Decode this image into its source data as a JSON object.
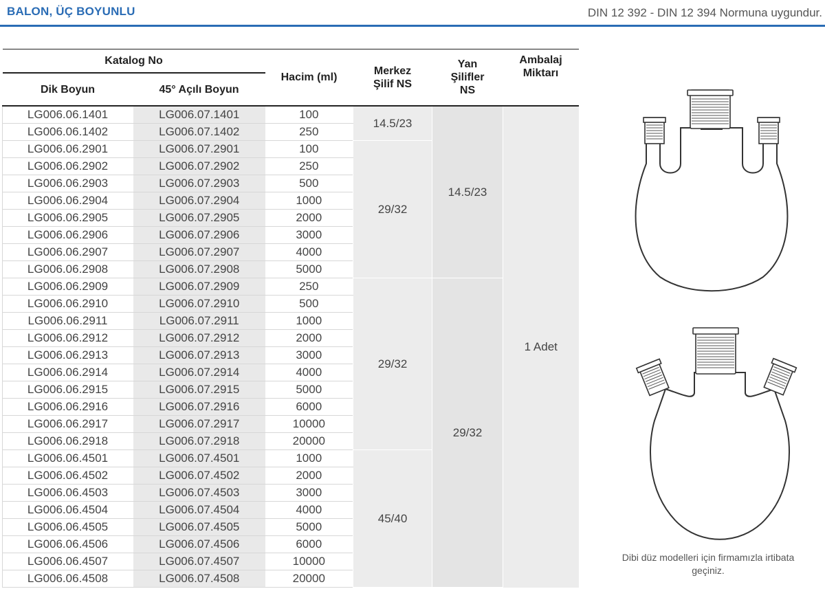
{
  "header": {
    "title": "BALON, ÜÇ BOYUNLU",
    "standard": "DIN 12 392 - DIN 12 394 Normuna uygundur."
  },
  "table": {
    "headers": {
      "katalog": "Katalog No",
      "dik": "Dik Boyun",
      "acili": "45° Açılı Boyun",
      "hacim": "Hacim (ml)",
      "merkez": "Merkez Şilif NS",
      "yan": "Yan Şilifler NS",
      "ambalaj": "Ambalaj Miktarı"
    },
    "rows": [
      {
        "dik": "LG006.06.1401",
        "acili": "LG006.07.1401",
        "hacim": "100"
      },
      {
        "dik": "LG006.06.1402",
        "acili": "LG006.07.1402",
        "hacim": "250"
      },
      {
        "dik": "LG006.06.2901",
        "acili": "LG006.07.2901",
        "hacim": "100"
      },
      {
        "dik": "LG006.06.2902",
        "acili": "LG006.07.2902",
        "hacim": "250"
      },
      {
        "dik": "LG006.06.2903",
        "acili": "LG006.07.2903",
        "hacim": "500"
      },
      {
        "dik": "LG006.06.2904",
        "acili": "LG006.07.2904",
        "hacim": "1000"
      },
      {
        "dik": "LG006.06.2905",
        "acili": "LG006.07.2905",
        "hacim": "2000"
      },
      {
        "dik": "LG006.06.2906",
        "acili": "LG006.07.2906",
        "hacim": "3000"
      },
      {
        "dik": "LG006.06.2907",
        "acili": "LG006.07.2907",
        "hacim": "4000"
      },
      {
        "dik": "LG006.06.2908",
        "acili": "LG006.07.2908",
        "hacim": "5000"
      },
      {
        "dik": "LG006.06.2909",
        "acili": "LG006.07.2909",
        "hacim": "250"
      },
      {
        "dik": "LG006.06.2910",
        "acili": "LG006.07.2910",
        "hacim": "500"
      },
      {
        "dik": "LG006.06.2911",
        "acili": "LG006.07.2911",
        "hacim": "1000"
      },
      {
        "dik": "LG006.06.2912",
        "acili": "LG006.07.2912",
        "hacim": "2000"
      },
      {
        "dik": "LG006.06.2913",
        "acili": "LG006.07.2913",
        "hacim": "3000"
      },
      {
        "dik": "LG006.06.2914",
        "acili": "LG006.07.2914",
        "hacim": "4000"
      },
      {
        "dik": "LG006.06.2915",
        "acili": "LG006.07.2915",
        "hacim": "5000"
      },
      {
        "dik": "LG006.06.2916",
        "acili": "LG006.07.2916",
        "hacim": "6000"
      },
      {
        "dik": "LG006.06.2917",
        "acili": "LG006.07.2917",
        "hacim": "10000"
      },
      {
        "dik": "LG006.06.2918",
        "acili": "LG006.07.2918",
        "hacim": "20000"
      },
      {
        "dik": "LG006.06.4501",
        "acili": "LG006.07.4501",
        "hacim": "1000"
      },
      {
        "dik": "LG006.06.4502",
        "acili": "LG006.07.4502",
        "hacim": "2000"
      },
      {
        "dik": "LG006.06.4503",
        "acili": "LG006.07.4503",
        "hacim": "3000"
      },
      {
        "dik": "LG006.06.4504",
        "acili": "LG006.07.4504",
        "hacim": "4000"
      },
      {
        "dik": "LG006.06.4505",
        "acili": "LG006.07.4505",
        "hacim": "5000"
      },
      {
        "dik": "LG006.06.4506",
        "acili": "LG006.07.4506",
        "hacim": "6000"
      },
      {
        "dik": "LG006.06.4507",
        "acili": "LG006.07.4507",
        "hacim": "10000"
      },
      {
        "dik": "LG006.06.4508",
        "acili": "LG006.07.4508",
        "hacim": "20000"
      }
    ],
    "merkez_groups": [
      {
        "value": "14.5/23",
        "rows": 2
      },
      {
        "value": "29/32",
        "rows": 8
      },
      {
        "value": "29/32",
        "rows": 10
      },
      {
        "value": "45/40",
        "rows": 8
      }
    ],
    "yan_groups": [
      {
        "value": "14.5/23",
        "rows": 10
      },
      {
        "value": "29/32",
        "rows": 18
      }
    ],
    "ambalaj": "1 Adet"
  },
  "note": "Dibi düz modelleri için firmamızla irtibata geçiniz."
}
